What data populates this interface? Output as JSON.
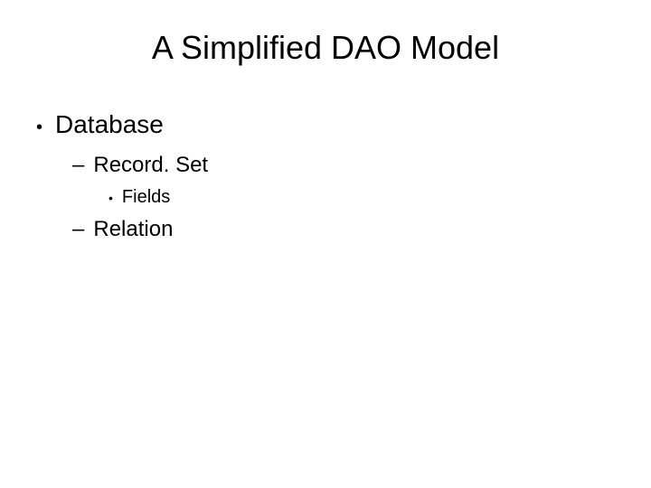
{
  "title": "A Simplified DAO Model",
  "items": {
    "l1_0": "Database",
    "l2_0": "Record. Set",
    "l3_0": "Fields",
    "l2_1": "Relation"
  }
}
